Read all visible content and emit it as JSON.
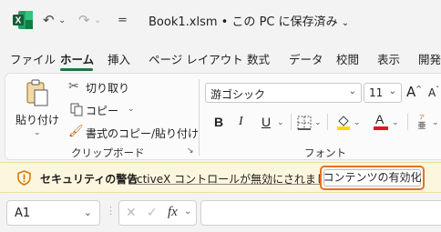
{
  "titlebar": {
    "title": "Book1.xlsm • この PC に保存済み",
    "title_caret": "⌄",
    "undo_icon": "↶",
    "redo_icon": "↷",
    "qat_more": "⌄",
    "customize": "="
  },
  "menu": {
    "items": [
      "ファイル",
      "ホーム",
      "挿入",
      "ページ レイアウト",
      "数式",
      "データ",
      "校閲",
      "表示",
      "開発"
    ],
    "active": "ホーム"
  },
  "ribbon": {
    "clipboard": {
      "paste": "貼り付け",
      "cut": "切り取り",
      "copy": "コピー",
      "format_painter": "書式のコピー/貼り付け",
      "group_label": "クリップボード"
    },
    "font": {
      "font_name": "游ゴシック",
      "font_size": "11",
      "grow": "A",
      "shrink": "A",
      "bold": "B",
      "italic": "I",
      "underline": "U",
      "fill_letter": "",
      "font_color_letter": "A",
      "group_label": "フォント",
      "fill_color": "#ffd800",
      "font_color": "#e81123"
    }
  },
  "security": {
    "title": "セキュリティの警告",
    "message": "ActiveX コントロールが無効にされました。",
    "button": "コンテンツの有効化",
    "accent": "#e07325"
  },
  "formula_bar": {
    "name_box": "A1",
    "cancel": "✕",
    "enter": "✓",
    "fx": "fx",
    "formula": ""
  }
}
